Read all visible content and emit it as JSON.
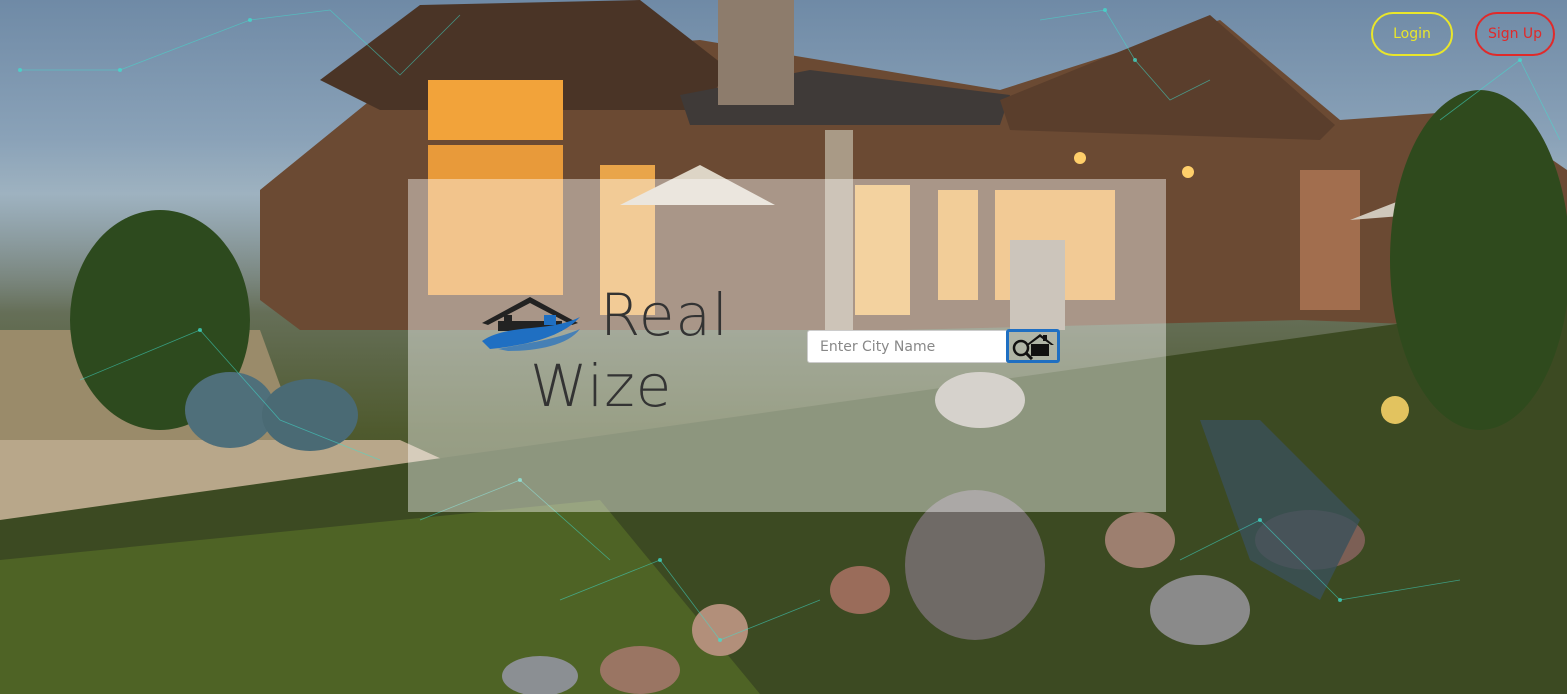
{
  "header": {
    "login_label": "Login",
    "signup_label": "Sign Up"
  },
  "brand": {
    "line1": "Real",
    "line2": "Wize",
    "icon": "house-logo-icon"
  },
  "search": {
    "placeholder": "Enter City Name",
    "value": "",
    "button_icon": "house-search-icon"
  },
  "colors": {
    "login_accent": "#e9e62a",
    "signup_accent": "#e02a2a",
    "search_button_border": "#1f6fc2",
    "logo_blue": "#1f6fc2",
    "logo_dark": "#222222"
  }
}
